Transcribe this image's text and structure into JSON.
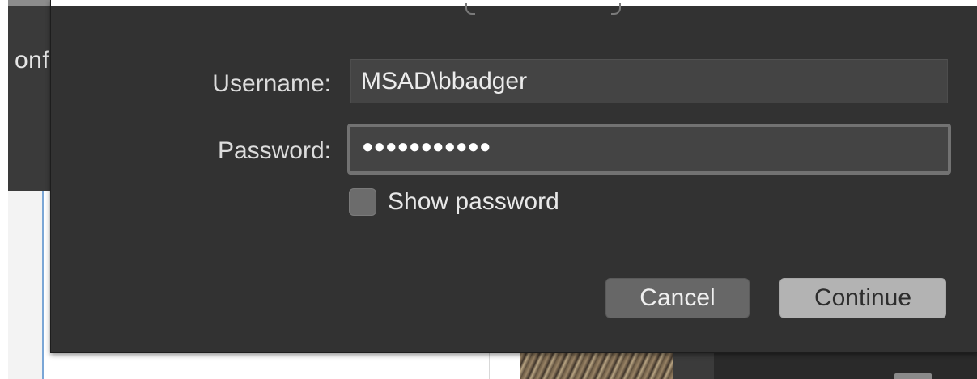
{
  "background": {
    "window_partial_text": "onfi"
  },
  "dialog": {
    "username_label": "Username:",
    "username_value": "MSAD\\bbadger",
    "password_label": "Password:",
    "password_masked": "●●●●●●●●●●●",
    "show_password_label": "Show password",
    "show_password_checked": false,
    "cancel_label": "Cancel",
    "continue_label": "Continue"
  },
  "colors": {
    "dialog_background": "#323232",
    "input_background": "#444444",
    "focus_ring": "#727272",
    "continue_button": "#b3b3b3",
    "cancel_button": "#676767"
  }
}
